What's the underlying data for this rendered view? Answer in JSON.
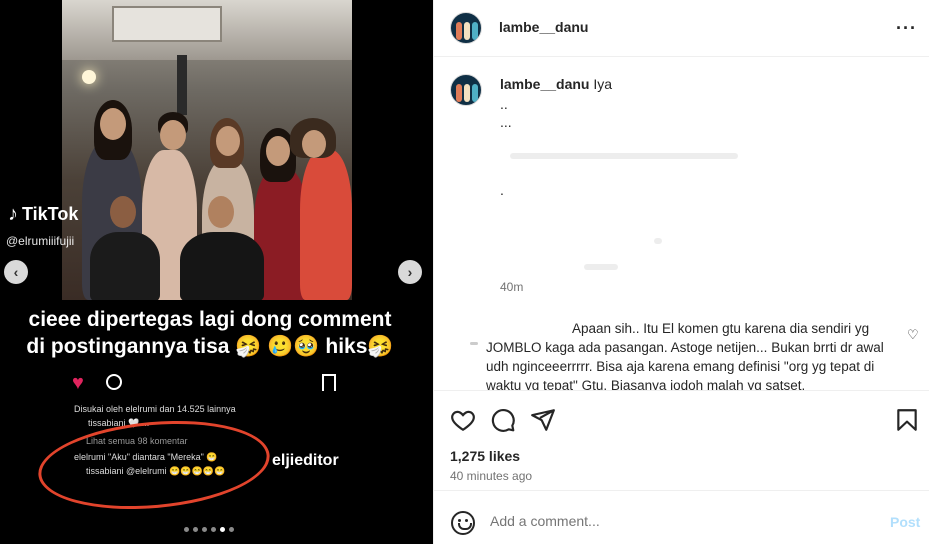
{
  "media": {
    "tiktok_brand": "TikTok",
    "tiktok_user": "@elrumiiifujii",
    "overlay_caption": "cieee dipertegas lagi dong comment di postingannya tisa 🤧 🥲🥹 hiks🤧",
    "mini_liked_by": "Disukai oleh elelrumi dan 14.525 lainnya",
    "mini_caption": "tissabiani 🤍 ...",
    "mini_view_all": "Lihat semua 98 komentar",
    "mini_comment_1": "elelrumi \"Aku\" diantara \"Mereka\" 😁",
    "mini_comment_2": "tissabiani @elelrumi 😁😁😁😁😁",
    "editor_watermark": "eljieditor",
    "slide_count": 6,
    "active_slide": 5,
    "heart_color": "#e0245e",
    "circle_color": "#e2442c"
  },
  "header": {
    "username": "lambe__danu",
    "more_icon": "more-horizontal-icon"
  },
  "caption": {
    "username": "lambe__danu",
    "text": "Iya",
    "lines": [
      "..",
      "...",
      "."
    ],
    "time": "40m"
  },
  "reply": {
    "text": "Apaan sih.. Itu El komen gtu karena dia sendiri yg JOMBLO kaga ada pasangan. Astoge netijen... Bukan brrti dr awal udh nginceeerrrrr. Bisa aja karena emang definisi \"org yg tepat di waktu yg tepat\" Gtu. Biasanya jodoh malah yg satset."
  },
  "actions": {
    "likes": "1,275 likes",
    "posted": "40 minutes ago"
  },
  "add_comment": {
    "placeholder": "Add a comment...",
    "post_label": "Post",
    "post_color": "#b2dffc"
  }
}
